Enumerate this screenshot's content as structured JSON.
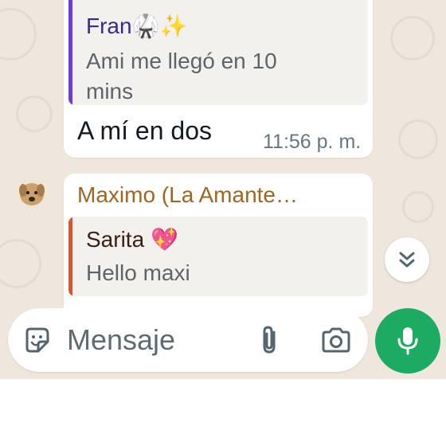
{
  "messages": [
    {
      "quote": {
        "author": "Fran",
        "author_emoji": "🥋✨",
        "text": "Ami me llegó en 10 mins",
        "accent": "#6f3ed8"
      },
      "text": "A mí en dos",
      "time": "11:56 p. m."
    },
    {
      "sender": "Maximo (La Amante…",
      "sender_color": "#a0661f",
      "quote": {
        "author": "Sarita",
        "author_emoji": "💖",
        "text": "Hello maxi",
        "accent": "#d45a2e"
      }
    }
  ],
  "composer": {
    "placeholder": "Mensaje"
  },
  "icons": {
    "sticker": "sticker-icon",
    "attach": "paperclip-icon",
    "camera": "camera-icon",
    "mic": "microphone-icon",
    "scroll": "double-chevron-down-icon"
  },
  "colors": {
    "chat_background": "#efe7de",
    "send_button": "#1daa61",
    "bubble": "#ffffff"
  }
}
